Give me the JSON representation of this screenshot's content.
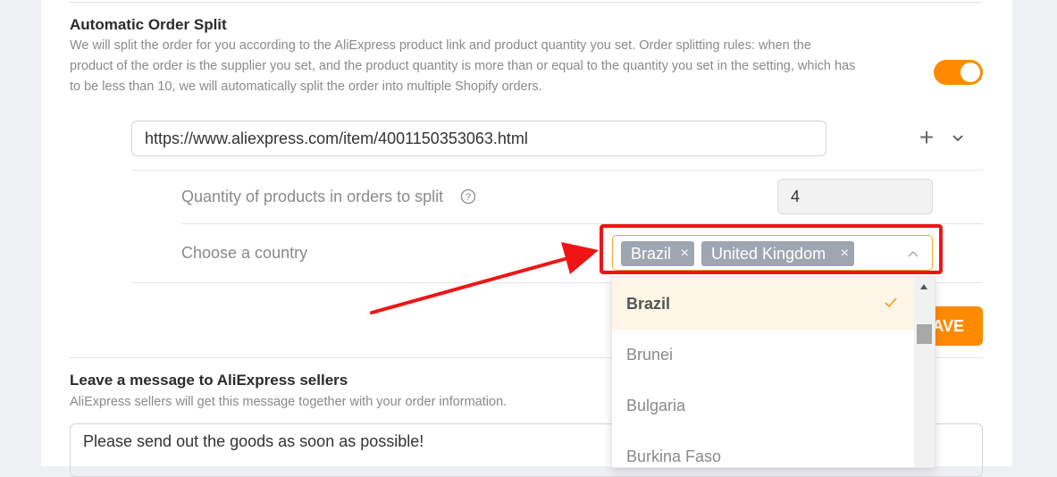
{
  "order_split": {
    "title": "Automatic Order Split",
    "description": "We will split the order for you according to the AliExpress product link and product quantity you set. Order splitting rules: when the product of the order is the supplier you set, and the product quantity is more than or equal to the quantity you set in the setting, which has to be less than 10, we will automatically split the order into multiple Shopify orders.",
    "enabled": true,
    "product_url": "https://www.aliexpress.com/item/4001150353063.html",
    "quantity_label": "Quantity of products in orders to split",
    "quantity_value": "4",
    "country_label": "Choose a country",
    "selected_countries": [
      "Brazil",
      "United Kingdom"
    ],
    "save_label": "SAVE"
  },
  "country_dropdown": {
    "options": [
      "Brazil",
      "Brunei",
      "Bulgaria",
      "Burkina Faso"
    ],
    "selected": "Brazil"
  },
  "message": {
    "title": "Leave a message to AliExpress sellers",
    "description": "AliExpress sellers will get this message together with your order information.",
    "text": "Please send out the goods as soon as possible!"
  },
  "colors": {
    "accent": "#ff8a00",
    "highlight": "#f01414",
    "tag": "#9ea6b0"
  },
  "icons": [
    "plus-icon",
    "chevron-down-icon",
    "help-icon",
    "close-icon",
    "chevron-up-icon",
    "check-icon",
    "annotation-arrow"
  ]
}
